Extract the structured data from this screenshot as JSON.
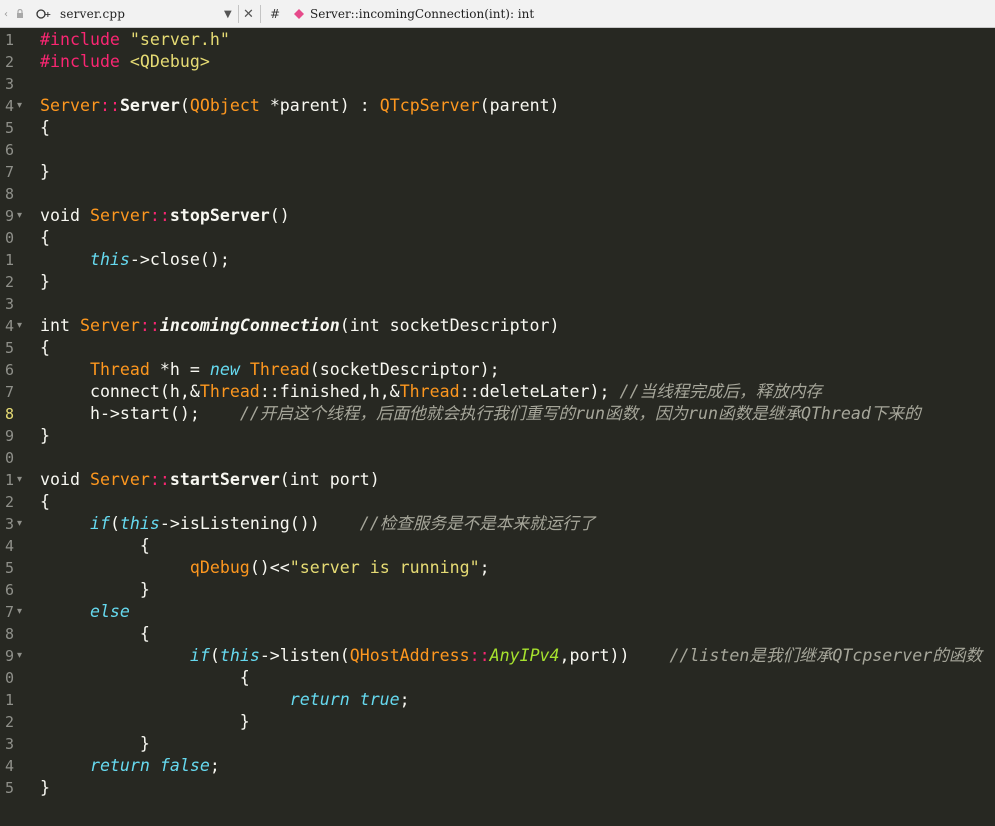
{
  "toolbar": {
    "file_name": "server.cpp",
    "dropdown_glyph": "▼",
    "close_glyph": "✕",
    "hash_label": "#",
    "symbol": "Server::incomingConnection(int): int",
    "icons": {
      "back": "chevron-left-icon",
      "lock": "lock-icon",
      "file": "cpp-file-icon",
      "symbol": "method-icon"
    }
  },
  "editor": {
    "current_line": 18,
    "lines": [
      {
        "n": "1",
        "fold": "",
        "tokens": [
          [
            "#include ",
            "pp"
          ],
          [
            "\"server.h\"",
            "str"
          ]
        ]
      },
      {
        "n": "2",
        "fold": "",
        "tokens": [
          [
            "#include ",
            "pp"
          ],
          [
            "<QDebug>",
            "str"
          ]
        ]
      },
      {
        "n": "3",
        "fold": "",
        "tokens": []
      },
      {
        "n": "4",
        "fold": "▾",
        "tokens": [
          [
            "Server",
            "cls"
          ],
          [
            "::",
            "punc"
          ],
          [
            "Server",
            "fn"
          ],
          [
            "(",
            "plain"
          ],
          [
            "QObject",
            "cls"
          ],
          [
            " *parent) : ",
            "plain"
          ],
          [
            "QTcpServer",
            "cls"
          ],
          [
            "(parent)",
            "plain"
          ]
        ]
      },
      {
        "n": "5",
        "fold": "",
        "tokens": [
          [
            "{",
            "plain"
          ]
        ]
      },
      {
        "n": "6",
        "fold": "",
        "tokens": []
      },
      {
        "n": "7",
        "fold": "",
        "tokens": [
          [
            "}",
            "plain"
          ]
        ]
      },
      {
        "n": "8",
        "fold": "",
        "tokens": []
      },
      {
        "n": "9",
        "fold": "▾",
        "tokens": [
          [
            "void ",
            "type"
          ],
          [
            "Server",
            "cls"
          ],
          [
            "::",
            "punc"
          ],
          [
            "stopServer",
            "fn"
          ],
          [
            "()",
            "plain"
          ]
        ]
      },
      {
        "n": "0",
        "fold": "",
        "tokens": [
          [
            "{",
            "plain"
          ]
        ]
      },
      {
        "n": "1",
        "fold": "",
        "tokens": [
          [
            "     ",
            "plain"
          ],
          [
            "this",
            "kw"
          ],
          [
            "->close();",
            "plain"
          ]
        ]
      },
      {
        "n": "2",
        "fold": "",
        "tokens": [
          [
            "}",
            "plain"
          ]
        ]
      },
      {
        "n": "3",
        "fold": "",
        "tokens": []
      },
      {
        "n": "4",
        "fold": "▾",
        "tokens": [
          [
            "int ",
            "type"
          ],
          [
            "Server",
            "cls"
          ],
          [
            "::",
            "punc"
          ],
          [
            "incomingConnection",
            "fni"
          ],
          [
            "(int socketDescriptor)",
            "plain"
          ]
        ]
      },
      {
        "n": "5",
        "fold": "",
        "tokens": [
          [
            "{",
            "plain"
          ]
        ]
      },
      {
        "n": "6",
        "fold": "",
        "tokens": [
          [
            "     ",
            "plain"
          ],
          [
            "Thread",
            "cls"
          ],
          [
            " *h = ",
            "plain"
          ],
          [
            "new ",
            "kw"
          ],
          [
            "Thread",
            "cls"
          ],
          [
            "(socketDescriptor);",
            "plain"
          ]
        ]
      },
      {
        "n": "7",
        "fold": "",
        "tokens": [
          [
            "     connect(h,&",
            "plain"
          ],
          [
            "Thread",
            "cls"
          ],
          [
            "::finished,h,&",
            "plain"
          ],
          [
            "Thread",
            "cls"
          ],
          [
            "::deleteLater); ",
            "plain"
          ],
          [
            "//当线程完成后，释放内存",
            "cmt"
          ]
        ]
      },
      {
        "n": "8",
        "fold": "",
        "tokens": [
          [
            "     h->start();    ",
            "plain"
          ],
          [
            "//开启这个线程，后面他就会执行我们重写的run函数，因为run函数是继承QThread下来的",
            "cmt"
          ]
        ]
      },
      {
        "n": "9",
        "fold": "",
        "tokens": [
          [
            "}",
            "plain"
          ]
        ]
      },
      {
        "n": "0",
        "fold": "",
        "tokens": []
      },
      {
        "n": "1",
        "fold": "▾",
        "tokens": [
          [
            "void ",
            "type"
          ],
          [
            "Server",
            "cls"
          ],
          [
            "::",
            "punc"
          ],
          [
            "startServer",
            "fn"
          ],
          [
            "(int port)",
            "plain"
          ]
        ]
      },
      {
        "n": "2",
        "fold": "",
        "tokens": [
          [
            "{",
            "plain"
          ]
        ]
      },
      {
        "n": "3",
        "fold": "▾",
        "tokens": [
          [
            "     ",
            "plain"
          ],
          [
            "if",
            "kw"
          ],
          [
            "(",
            "plain"
          ],
          [
            "this",
            "kw"
          ],
          [
            "->isListening())    ",
            "plain"
          ],
          [
            "//检查服务是不是本来就运行了",
            "cmt"
          ]
        ]
      },
      {
        "n": "4",
        "fold": "",
        "tokens": [
          [
            "          {",
            "plain"
          ]
        ]
      },
      {
        "n": "5",
        "fold": "",
        "tokens": [
          [
            "               ",
            "plain"
          ],
          [
            "qDebug",
            "cls"
          ],
          [
            "()<<",
            "plain"
          ],
          [
            "\"server is running\"",
            "str"
          ],
          [
            ";",
            "plain"
          ]
        ]
      },
      {
        "n": "6",
        "fold": "",
        "tokens": [
          [
            "          }",
            "plain"
          ]
        ]
      },
      {
        "n": "7",
        "fold": "▾",
        "tokens": [
          [
            "     ",
            "plain"
          ],
          [
            "else",
            "kw"
          ]
        ]
      },
      {
        "n": "8",
        "fold": "",
        "tokens": [
          [
            "          {",
            "plain"
          ]
        ]
      },
      {
        "n": "9",
        "fold": "▾",
        "tokens": [
          [
            "               ",
            "plain"
          ],
          [
            "if",
            "kw"
          ],
          [
            "(",
            "plain"
          ],
          [
            "this",
            "kw"
          ],
          [
            "->listen(",
            "plain"
          ],
          [
            "QHostAddress",
            "cls"
          ],
          [
            "::",
            "punc"
          ],
          [
            "AnyIPv4",
            "en"
          ],
          [
            ",port))    ",
            "plain"
          ],
          [
            "//listen是我们继承QTcpserver的函数",
            "cmt"
          ]
        ]
      },
      {
        "n": "0",
        "fold": "",
        "tokens": [
          [
            "                    {",
            "plain"
          ]
        ]
      },
      {
        "n": "1",
        "fold": "",
        "tokens": [
          [
            "                         ",
            "plain"
          ],
          [
            "return ",
            "kw"
          ],
          [
            "true",
            "kw"
          ],
          [
            ";",
            "plain"
          ]
        ]
      },
      {
        "n": "2",
        "fold": "",
        "tokens": [
          [
            "                    }",
            "plain"
          ]
        ]
      },
      {
        "n": "3",
        "fold": "",
        "tokens": [
          [
            "          }",
            "plain"
          ]
        ]
      },
      {
        "n": "4",
        "fold": "",
        "tokens": [
          [
            "     ",
            "plain"
          ],
          [
            "return ",
            "kw"
          ],
          [
            "false",
            "kw"
          ],
          [
            ";",
            "plain"
          ]
        ]
      },
      {
        "n": "5",
        "fold": "",
        "tokens": [
          [
            "}",
            "plain"
          ]
        ]
      }
    ]
  },
  "colors": {
    "background": "#272822",
    "foreground": "#f8f8f2",
    "keyword": "#66d9ef",
    "string": "#e6db74",
    "class": "#fd971f",
    "preprocessor": "#f92672",
    "comment": "#a6a69a",
    "enum": "#a6e22e",
    "toolbar_bg": "#f2f2f2"
  }
}
